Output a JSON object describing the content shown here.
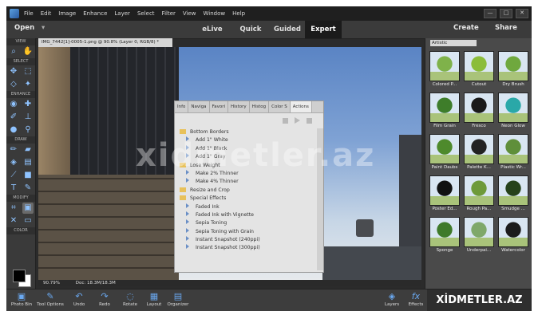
{
  "menu": [
    "File",
    "Edit",
    "Image",
    "Enhance",
    "Layer",
    "Select",
    "Filter",
    "View",
    "Window",
    "Help"
  ],
  "window_buttons": [
    "—",
    "□",
    "✕"
  ],
  "modebar": {
    "open": "Open",
    "create": "Create",
    "share": "Share",
    "tabs": [
      "eLive",
      "Quick",
      "Guided",
      "Expert"
    ],
    "active": "Expert"
  },
  "tool_sections": {
    "view": "VIEW",
    "select": "SELECT",
    "enhance": "ENHANCE",
    "draw": "DRAW",
    "modify": "MODIFY",
    "color": "COLOR"
  },
  "document": {
    "tab_title": "IMG_7442[1]-0005-1.png @ 90.8% (Layer 0, RGB/8) *",
    "zoom": "90.79%",
    "doc_size": "Doc: 18.3M/18.3M"
  },
  "panel": {
    "tabs": [
      "Info",
      "Naviga",
      "Favori",
      "History",
      "Histog",
      "Color S",
      "Actions"
    ],
    "active_tab": "Actions",
    "items": [
      {
        "type": "folder",
        "label": "Bottom Borders"
      },
      {
        "type": "action",
        "label": "Add 1\" White"
      },
      {
        "type": "action",
        "label": "Add 1\" Black"
      },
      {
        "type": "action",
        "label": "Add 1\" Gray"
      },
      {
        "type": "folder",
        "label": "Lose Weight"
      },
      {
        "type": "action",
        "label": "Make 2% Thinner"
      },
      {
        "type": "action",
        "label": "Make 4% Thinner"
      },
      {
        "type": "folder",
        "label": "Resize and Crop"
      },
      {
        "type": "folder",
        "label": "Special Effects"
      },
      {
        "type": "action",
        "label": "Faded Ink"
      },
      {
        "type": "action",
        "label": "Faded Ink with Vignette"
      },
      {
        "type": "action",
        "label": "Sepia Toning"
      },
      {
        "type": "action",
        "label": "Sepia Toning with Grain"
      },
      {
        "type": "action",
        "label": "Instant Snapshot (240ppi)"
      },
      {
        "type": "action",
        "label": "Instant Snapshot (300ppi)"
      }
    ]
  },
  "filters": {
    "category": "Artistic",
    "items": [
      {
        "label": "Colored P...",
        "color": "#7fb24a"
      },
      {
        "label": "Cutout",
        "color": "#8bbd3a"
      },
      {
        "label": "Dry Brush",
        "color": "#6fa83e"
      },
      {
        "label": "Film Grain",
        "color": "#3e7d2a"
      },
      {
        "label": "Fresco",
        "color": "#1a1a1a"
      },
      {
        "label": "Neon Glow",
        "color": "#2aa8a8"
      },
      {
        "label": "Paint Daubs",
        "color": "#4e8a2c"
      },
      {
        "label": "Palette K...",
        "color": "#222222"
      },
      {
        "label": "Plastic Wr...",
        "color": "#5f8f3a"
      },
      {
        "label": "Poster Ed...",
        "color": "#111111"
      },
      {
        "label": "Rough Pa...",
        "color": "#6e9a3a"
      },
      {
        "label": "Smudge ...",
        "color": "#26421a"
      },
      {
        "label": "Sponge",
        "color": "#3f7a2a"
      },
      {
        "label": "Underpai...",
        "color": "#7fa86a"
      },
      {
        "label": "Watercolor",
        "color": "#1c1c1c"
      }
    ]
  },
  "bottombar": {
    "left": [
      {
        "label": "Photo Bin",
        "icon": "▣"
      },
      {
        "label": "Tool Options",
        "icon": "✎"
      },
      {
        "label": "Undo",
        "icon": "↶"
      },
      {
        "label": "Redo",
        "icon": "↷"
      },
      {
        "label": "Rotate",
        "icon": "◌"
      },
      {
        "label": "Layout",
        "icon": "▦"
      },
      {
        "label": "Organizer",
        "icon": "▤"
      }
    ],
    "right": [
      {
        "label": "Layers",
        "icon": "◈"
      },
      {
        "label": "Effects",
        "icon": "fx"
      }
    ]
  },
  "watermark": "xidmetler.az",
  "brand": "XİDMETLER.AZ"
}
